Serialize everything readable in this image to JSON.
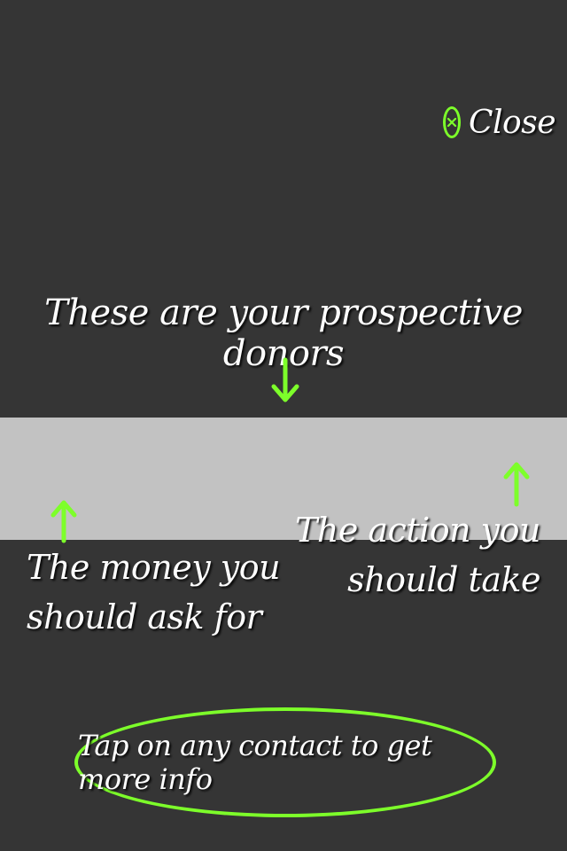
{
  "close": {
    "icon": "close-x-icon",
    "label": "Close"
  },
  "headline": "These are your prospective donors",
  "annotations": {
    "left": {
      "line1": "The money you",
      "line2": "should ask for"
    },
    "right": {
      "line1": "The action you",
      "line2": "should take"
    }
  },
  "hint": "Tap on any contact to get more info",
  "colors": {
    "accent": "#7dff2a",
    "background": "#353535",
    "row": "#c2c2c2",
    "text": "#ffffff"
  },
  "icons": {
    "down": "arrow-down-icon",
    "up_left": "arrow-up-icon",
    "up_right": "arrow-up-icon"
  }
}
